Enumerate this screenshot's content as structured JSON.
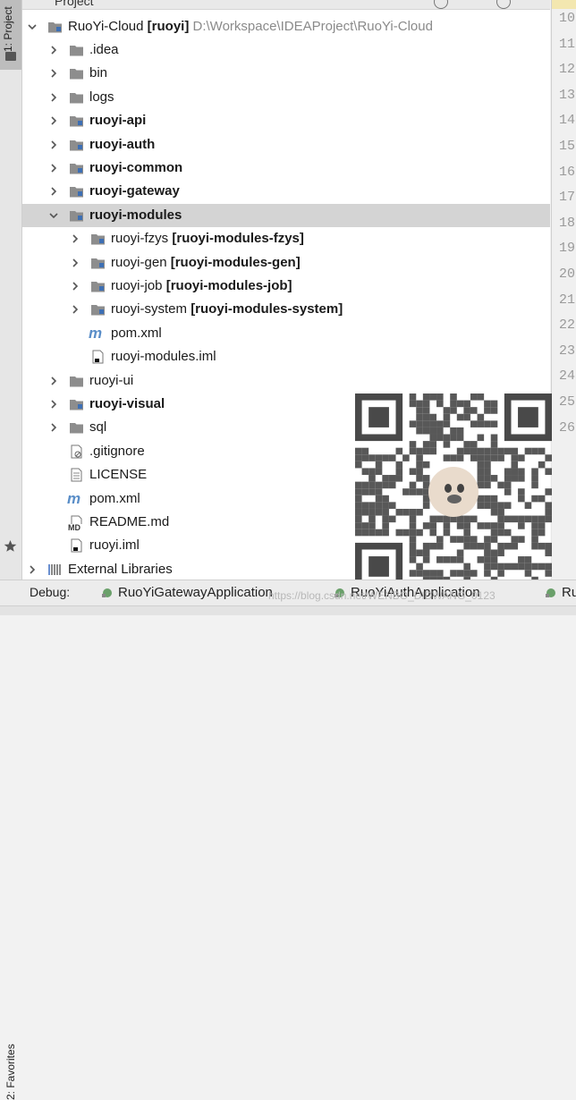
{
  "side_tabs": {
    "project": "1: Project",
    "favorites": "2: Favorites"
  },
  "panel_header": {
    "title": "Project"
  },
  "colors": {
    "folder": "#8d8d8d",
    "module_folder": "#8d8d8d",
    "module_dot": "#3d6fb4",
    "selected_row": "#d4d4d4",
    "maven_m": "#5a8ec8"
  },
  "tree": {
    "root_name": "RuoYi-Cloud",
    "root_module": "[ruoyi]",
    "root_path": "D:\\Workspace\\IDEAProject\\RuoYi-Cloud",
    "items": [
      {
        "label": ".idea",
        "icon": "folder-icon"
      },
      {
        "label": "bin",
        "icon": "folder-icon"
      },
      {
        "label": "logs",
        "icon": "folder-icon"
      },
      {
        "label": "ruoyi-api",
        "icon": "module-folder-icon"
      },
      {
        "label": "ruoyi-auth",
        "icon": "module-folder-icon"
      },
      {
        "label": "ruoyi-common",
        "icon": "module-folder-icon"
      },
      {
        "label": "ruoyi-gateway",
        "icon": "module-folder-icon"
      },
      {
        "label": "ruoyi-modules",
        "icon": "module-folder-icon"
      },
      {
        "label": "ruoyi-fzys",
        "module": "[ruoyi-modules-fzys]",
        "icon": "module-folder-icon"
      },
      {
        "label": "ruoyi-gen",
        "module": "[ruoyi-modules-gen]",
        "icon": "module-folder-icon"
      },
      {
        "label": "ruoyi-job",
        "module": "[ruoyi-modules-job]",
        "icon": "module-folder-icon"
      },
      {
        "label": "ruoyi-system",
        "module": "[ruoyi-modules-system]",
        "icon": "module-folder-icon"
      },
      {
        "label": "pom.xml",
        "icon": "maven-icon"
      },
      {
        "label": "ruoyi-modules.iml",
        "icon": "iml-file-icon"
      },
      {
        "label": "ruoyi-ui",
        "icon": "folder-icon"
      },
      {
        "label": "ruoyi-visual",
        "icon": "module-folder-icon"
      },
      {
        "label": "sql",
        "icon": "folder-icon"
      },
      {
        "label": ".gitignore",
        "icon": "gitignore-icon"
      },
      {
        "label": "LICENSE",
        "icon": "text-file-icon"
      },
      {
        "label": "pom.xml",
        "icon": "maven-icon"
      },
      {
        "label": "README.md",
        "icon": "markdown-icon",
        "badge": "MD"
      },
      {
        "label": "ruoyi.iml",
        "icon": "iml-file-icon"
      },
      {
        "label": "External Libraries",
        "icon": "libraries-icon"
      }
    ]
  },
  "gutter": {
    "line_numbers": [
      "10",
      "11",
      "12",
      "13",
      "14",
      "15",
      "16",
      "17",
      "18",
      "19",
      "20",
      "21",
      "22",
      "23",
      "24",
      "25",
      "26"
    ]
  },
  "debug": {
    "label": "Debug:",
    "tabs": [
      "RuoYiGatewayApplication",
      "RuoYiAuthApplication",
      "Ru"
    ],
    "watermark": "https://blog.csdn.net/WENBO_DIDWANG_0123"
  }
}
